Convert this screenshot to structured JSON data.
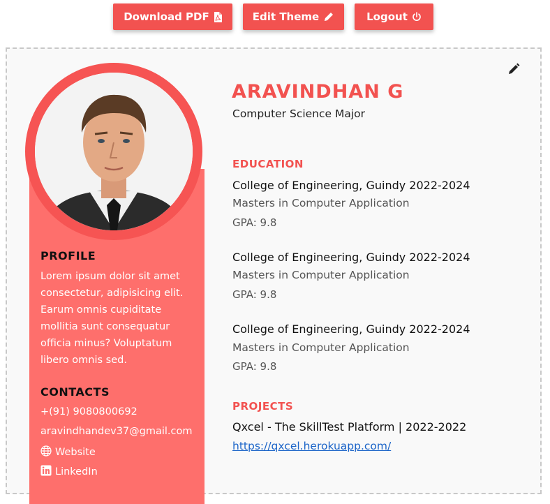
{
  "toolbar": {
    "download_label": "Download PDF",
    "edit_theme_label": "Edit Theme",
    "logout_label": "Logout"
  },
  "profile": {
    "name": "ARAVINDHAN G",
    "role": "Computer Science Major",
    "heading": "PROFILE",
    "text": "Lorem ipsum dolor sit amet consectetur, adipisicing elit. Earum omnis cupiditate mollitia sunt consequatur officia minus? Voluptatum libero omnis sed."
  },
  "contacts": {
    "heading": "CONTACTS",
    "phone": "+(91) 9080800692",
    "email": "aravindhandev37@gmail.com",
    "website": "Website",
    "linkedin": "LinkedIn"
  },
  "education": {
    "heading": "EDUCATION",
    "items": [
      {
        "title": "College of Engineering, Guindy 2022-2024",
        "degree": "Masters in Computer Application",
        "gpa": "GPA: 9.8"
      },
      {
        "title": "College of Engineering, Guindy 2022-2024",
        "degree": "Masters in Computer Application",
        "gpa": "GPA: 9.8"
      },
      {
        "title": "College of Engineering, Guindy 2022-2024",
        "degree": "Masters in Computer Application",
        "gpa": "GPA: 9.8"
      }
    ]
  },
  "projects": {
    "heading": "PROJECTS",
    "items": [
      {
        "title": "Qxcel - The SkillTest Platform | 2022-2022",
        "link": "https://qxcel.herokuapp.com/"
      }
    ]
  },
  "colors": {
    "accent": "#f25250",
    "sidebar": "#fe6f6c",
    "link": "#1b64c8"
  },
  "icons": [
    "pdf-file-icon",
    "pencil-icon",
    "power-icon",
    "globe-icon",
    "linkedin-icon"
  ]
}
